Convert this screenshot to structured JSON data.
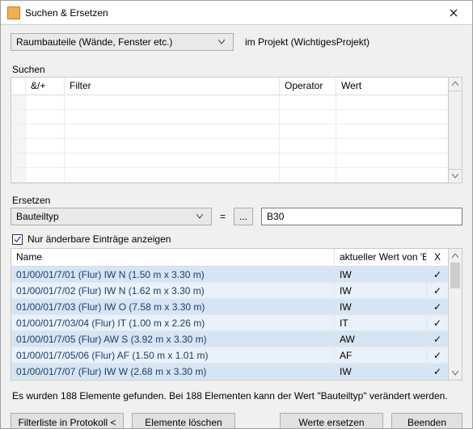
{
  "window": {
    "title": "Suchen & Ersetzen"
  },
  "scope": {
    "value": "Raumbauteile (Wände, Fenster etc.)",
    "context": "im Projekt (WichtigesProjekt)"
  },
  "search": {
    "section_label": "Suchen",
    "headers": {
      "andor": "&/+",
      "filter": "Filter",
      "operator": "Operator",
      "wert": "Wert"
    }
  },
  "replace": {
    "section_label": "Ersetzen",
    "field": "Bauteiltyp",
    "equals": "=",
    "dots": "...",
    "value": "B30"
  },
  "checkbox": {
    "label": "Nur änderbare Einträge anzeigen"
  },
  "results": {
    "headers": {
      "name": "Name",
      "current": "aktueller Wert von 'Bauteiltyp'",
      "x": "X"
    },
    "rows": [
      {
        "name": "01/00/01/7/01 (Flur) IW N (1.50 m x 3.30 m)",
        "cur": "IW",
        "x": "✓"
      },
      {
        "name": "01/00/01/7/02 (Flur) IW N (1.62 m x 3.30 m)",
        "cur": "IW",
        "x": "✓"
      },
      {
        "name": "01/00/01/7/03 (Flur) IW O (7.58 m x 3.30 m)",
        "cur": "IW",
        "x": "✓"
      },
      {
        "name": "01/00/01/7/03/04 (Flur) IT (1.00 m x 2.26 m)",
        "cur": "IT",
        "x": "✓"
      },
      {
        "name": "01/00/01/7/05 (Flur) AW S (3.92 m x 3.30 m)",
        "cur": "AW",
        "x": "✓"
      },
      {
        "name": "01/00/01/7/05/06 (Flur) AF (1.50 m x 1.01 m)",
        "cur": "AF",
        "x": "✓"
      },
      {
        "name": "01/00/01/7/07 (Flur) IW W (2.68 m x 3.30 m)",
        "cur": "IW",
        "x": "✓"
      }
    ]
  },
  "status": "Es wurden 188 Elemente gefunden. Bei 188 Elementen kann der Wert \"Bauteiltyp\" verändert werden.",
  "buttons": {
    "protocol": "Filterliste in Protokoll <",
    "delete": "Elemente löschen",
    "replace": "Werte ersetzen",
    "close": "Beenden"
  }
}
